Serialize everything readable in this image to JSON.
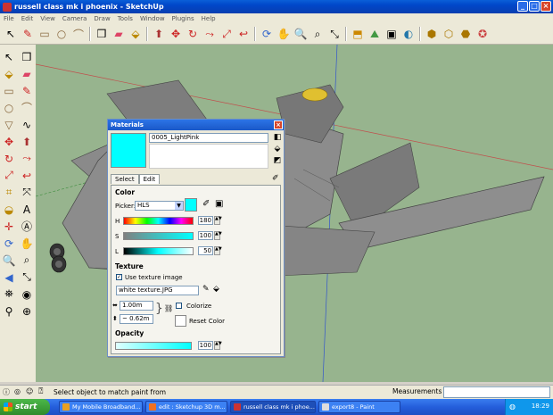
{
  "window": {
    "title": "russell class mk i phoenix - SketchUp"
  },
  "menu": [
    "File",
    "Edit",
    "View",
    "Camera",
    "Draw",
    "Tools",
    "Window",
    "Plugins",
    "Help"
  ],
  "materials": {
    "title": "Materials",
    "name": "0005_LightPink",
    "tabs": [
      "Select",
      "Edit"
    ],
    "color_label": "Color",
    "picker_label": "Picker:",
    "picker_value": "HLS",
    "h_label": "H",
    "h_value": "180",
    "s_label": "S",
    "s_value": "100",
    "l_label": "L",
    "l_value": "50",
    "texture_label": "Texture",
    "use_texture_label": "Use texture image",
    "texture_file": "white texture.JPG",
    "width_value": "1.00m",
    "height_value": "~ 0.62m",
    "colorize_label": "Colorize",
    "reset_color_label": "Reset Color",
    "opacity_label": "Opacity",
    "opacity_value": "100",
    "swatch_color": "#00ffff"
  },
  "status": {
    "hint": "Select object to match paint from",
    "measurements_label": "Measurements"
  },
  "taskbar": {
    "start_label": "start",
    "tasks": [
      "My Mobile Broadband...",
      "edit : Sketchup 3D m...",
      "russell class mk i phoe...",
      "export8 - Paint"
    ],
    "clock": "18:29"
  }
}
